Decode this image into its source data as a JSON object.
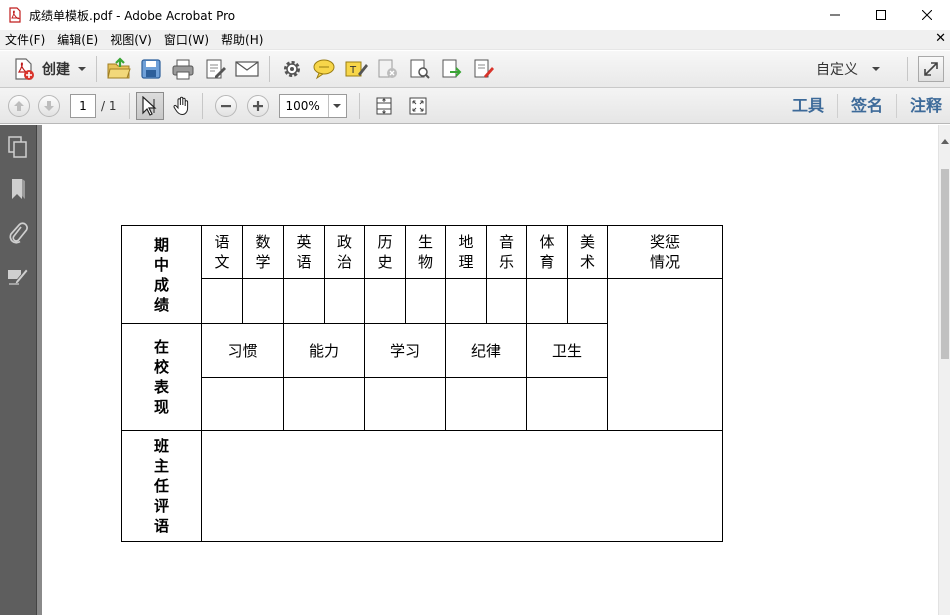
{
  "window": {
    "title": "成绩单模板.pdf - Adobe Acrobat Pro"
  },
  "menu": [
    "文件(F)",
    "编辑(E)",
    "视图(V)",
    "窗口(W)",
    "帮助(H)"
  ],
  "toolbar": {
    "create_label": "创建",
    "customize_label": "自定义"
  },
  "nav": {
    "page_current": "1",
    "page_total": "/ 1",
    "zoom": "100%"
  },
  "right_tabs": [
    "工具",
    "签名",
    "注释"
  ],
  "report": {
    "midterm_label": "期\n中\n成\n绩",
    "subjects": [
      "语\n文",
      "数\n学",
      "英\n语",
      "政\n治",
      "历\n史",
      "生\n物",
      "地\n理",
      "音\n乐",
      "体\n育",
      "美\n术"
    ],
    "rewards_label": "奖惩\n情况",
    "school_label": "在\n校\n表\n现",
    "behaviors": [
      "习惯",
      "能力",
      "学习",
      "纪律",
      "卫生"
    ],
    "comment_label": "班\n主\n任\n评\n语"
  },
  "colors": {
    "tab_blue": "#3d6a99",
    "left_pane": "#5e5e5e"
  }
}
